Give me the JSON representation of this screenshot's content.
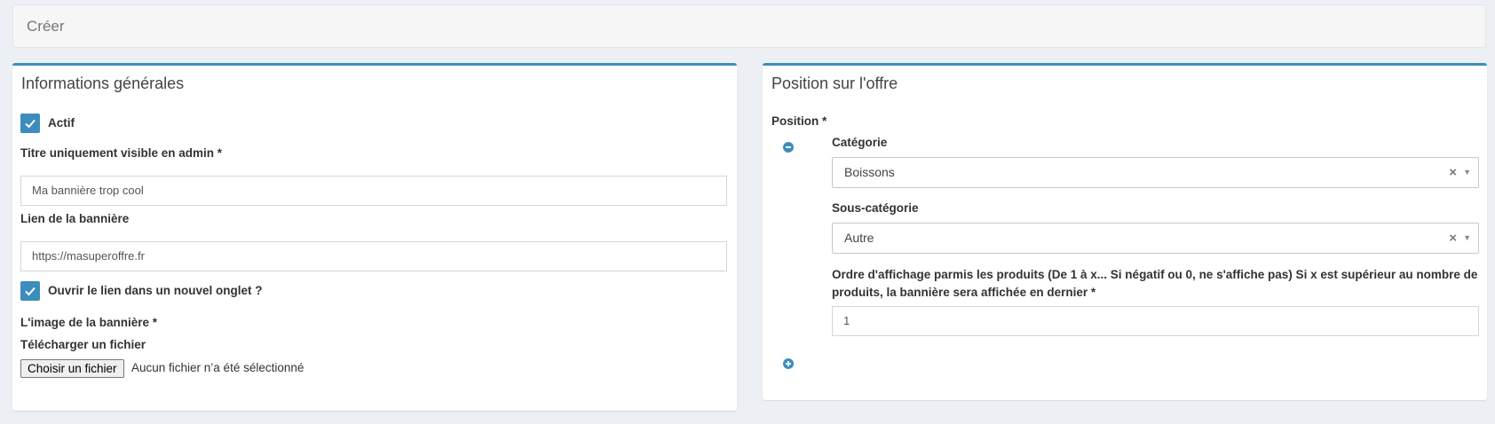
{
  "header": {
    "title": "Créer"
  },
  "general": {
    "title": "Informations générales",
    "active_label": "Actif",
    "admin_title_label": "Titre uniquement visible en admin *",
    "admin_title_value": "Ma bannière trop cool",
    "link_label": "Lien de la bannière",
    "link_value": "https://masuperoffre.fr",
    "new_tab_label": "Ouvrir le lien dans un nouvel onglet ?",
    "image_label": "L'image de la bannière *",
    "upload_label": "Télécharger un fichier",
    "file_button": "Choisir un fichier",
    "file_status": "Aucun fichier n’a été sélectionné"
  },
  "position": {
    "title": "Position sur l'offre",
    "position_label": "Position *",
    "category_label": "Catégorie",
    "category_value": "Boissons",
    "subcategory_label": "Sous-catégorie",
    "subcategory_value": "Autre",
    "order_label_part1": "Ordre d'affichage parmis les produits (De 1 à x... Si négatif ou 0, ne s'affiche pas) Si x est supérieur au nombre de",
    "order_label_part2": "produits, la bannière sera affichée en dernier *",
    "order_value": "1",
    "clear_symbol": "×",
    "dropdown_symbol": "▼"
  },
  "colors": {
    "accent": "#3c8dbc",
    "background": "#ecf0f5"
  }
}
